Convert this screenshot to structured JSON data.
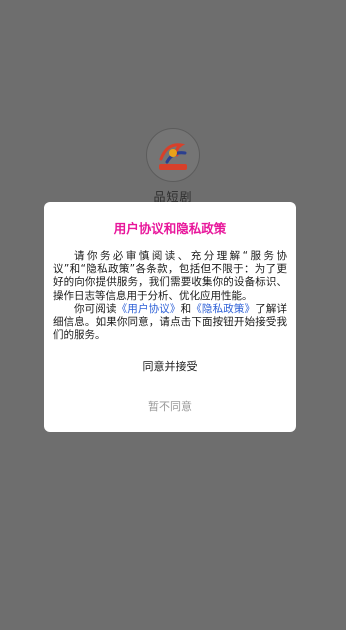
{
  "app": {
    "name": "品短剧",
    "logo_text": "品短剧"
  },
  "dialog": {
    "title": "用户协议和隐私政策",
    "paragraph1": "请你务必审慎阅读、充分理解“服务协议”和“隐私政策”各条款，包括但不限于：为了更好的向你提供服务，我们需要收集你的设备标识、操作日志等信息用于分析、优化应用性能。",
    "p2_prefix": "你可阅读",
    "user_agreement_link": "《用户协议》",
    "p2_and": "和",
    "privacy_policy_link": "《隐私政策》",
    "p2_suffix": "了解详细信息。如果你同意，请点击下面按钮开始接受我们的服务。",
    "agree_label": "同意并接受",
    "disagree_label": "暂不同意"
  },
  "colors": {
    "overlay_background": "#6e6e6e",
    "title": "#e8179b",
    "link": "#2c5fd6",
    "disagree_text": "#9a9a9a"
  }
}
